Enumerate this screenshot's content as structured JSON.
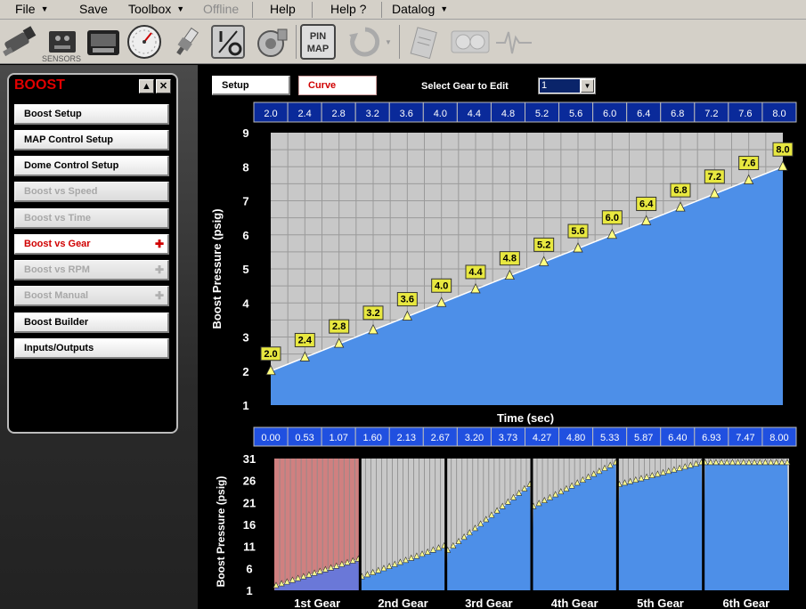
{
  "menu": {
    "file": "File",
    "save": "Save",
    "toolbox": "Toolbox",
    "offline": "Offline",
    "help": "Help",
    "help_q": "Help ?",
    "datalog": "Datalog"
  },
  "toolbar": {
    "sensors_caption": "SENSORS",
    "pin_map_line1": "PIN",
    "pin_map_line2": "MAP"
  },
  "sidebar": {
    "title": "BOOST",
    "minimize": "▲",
    "close": "✕",
    "items": [
      {
        "label": "Boost Setup",
        "state": "normal",
        "plus": false
      },
      {
        "label": "MAP Control Setup",
        "state": "normal",
        "plus": false
      },
      {
        "label": "Dome Control Setup",
        "state": "normal",
        "plus": false
      },
      {
        "label": "Boost vs Speed",
        "state": "disabled",
        "plus": false
      },
      {
        "label": "Boost vs Time",
        "state": "disabled",
        "plus": false
      },
      {
        "label": "Boost vs Gear",
        "state": "active",
        "plus": true
      },
      {
        "label": "Boost vs RPM",
        "state": "disabled",
        "plus": true
      },
      {
        "label": "Boost Manual",
        "state": "disabled",
        "plus": true
      },
      {
        "label": "Boost Builder",
        "state": "normal",
        "plus": false
      },
      {
        "label": "Inputs/Outputs",
        "state": "normal",
        "plus": false
      }
    ]
  },
  "main": {
    "setup_button": "Setup",
    "curve_button": "Curve",
    "gear_select_label": "Select Gear to Edit",
    "gear_select_value": "1"
  },
  "colors": {
    "fill_blue": "#4d8fe8",
    "label_yellow": "#e8e840",
    "gear1_red": "#d08080",
    "cell_blue": "#0a2a9a"
  },
  "chart_data": [
    {
      "type": "area",
      "top_row_values": [
        "2.0",
        "2.4",
        "2.8",
        "3.2",
        "3.6",
        "4.0",
        "4.4",
        "4.8",
        "5.2",
        "5.6",
        "6.0",
        "6.4",
        "6.8",
        "7.2",
        "7.6",
        "8.0"
      ],
      "x": [
        0,
        1,
        2,
        3,
        4,
        5,
        6,
        7,
        8,
        9,
        10,
        11,
        12,
        13,
        14,
        15
      ],
      "y": [
        2.0,
        2.4,
        2.8,
        3.2,
        3.6,
        4.0,
        4.4,
        4.8,
        5.2,
        5.6,
        6.0,
        6.4,
        6.8,
        7.2,
        7.6,
        8.0
      ],
      "point_labels": [
        "2.0",
        "2.4",
        "2.8",
        "3.2",
        "3.6",
        "4.0",
        "4.4",
        "4.8",
        "5.2",
        "5.6",
        "6.0",
        "6.4",
        "6.8",
        "7.2",
        "7.6",
        "8.0"
      ],
      "xlabel": "Time (sec)",
      "ylabel": "Boost Pressure (psig)",
      "y_ticks": [
        "1",
        "2",
        "3",
        "4",
        "5",
        "6",
        "7",
        "8",
        "9"
      ],
      "ylim": [
        1,
        9
      ],
      "grid": true
    },
    {
      "type": "area",
      "time_row_values": [
        "0.00",
        "0.53",
        "1.07",
        "1.60",
        "2.13",
        "2.67",
        "3.20",
        "3.73",
        "4.27",
        "4.80",
        "5.33",
        "5.87",
        "6.40",
        "6.93",
        "7.47",
        "8.00"
      ],
      "ylabel": "Boost Pressure (psig)",
      "y_ticks": [
        "1",
        "6",
        "11",
        "16",
        "21",
        "26",
        "31"
      ],
      "ylim": [
        1,
        31
      ],
      "gears": [
        {
          "name": "1st Gear",
          "y_start": 2.0,
          "y_end": 8.0
        },
        {
          "name": "2nd Gear",
          "y_start": 4.0,
          "y_end": 11.0
        },
        {
          "name": "3rd Gear",
          "y_start": 10.0,
          "y_end": 25.0
        },
        {
          "name": "4th Gear",
          "y_start": 20.0,
          "y_end": 30.0
        },
        {
          "name": "5th Gear",
          "y_start": 25.0,
          "y_end": 30.0
        },
        {
          "name": "6th Gear",
          "y_start": 30.0,
          "y_end": 30.0
        }
      ],
      "grid": true
    }
  ]
}
